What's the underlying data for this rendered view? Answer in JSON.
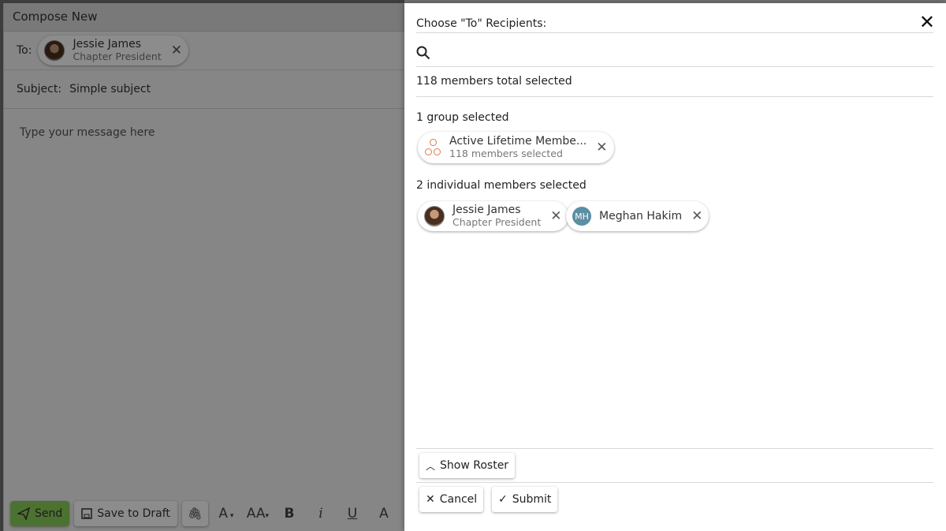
{
  "compose": {
    "title": "Compose New",
    "to_label": "To:",
    "to_chip": {
      "name": "Jessie James",
      "subtitle": "Chapter President"
    },
    "subject_label": "Subject:",
    "subject_value": "Simple subject",
    "message_placeholder": "Type your message here",
    "toolbar": {
      "send": "Send",
      "save_draft": "Save to Draft",
      "font_color": "A",
      "font_size": "AA"
    }
  },
  "panel": {
    "title": "Choose \"To\" Recipients:",
    "total_selected": "118 members total selected",
    "group_section": "1 group selected",
    "group_chip": {
      "name": "Active Lifetime Membe...",
      "subtitle": "118 members selected"
    },
    "individual_section": "2 individual members selected",
    "individuals": [
      {
        "name": "Jessie James",
        "subtitle": "Chapter President"
      },
      {
        "name": "Meghan Hakim",
        "initials": "MH"
      }
    ],
    "show_roster": "Show Roster",
    "cancel": "Cancel",
    "submit": "Submit"
  }
}
